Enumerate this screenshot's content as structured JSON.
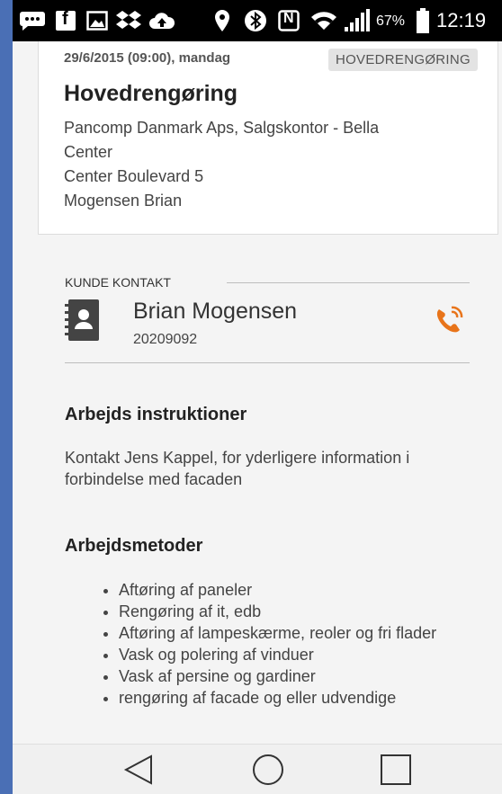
{
  "status_bar": {
    "icons": [
      "chat-icon",
      "facebook-icon",
      "image-icon",
      "dropbox-icon",
      "cloud-upload-icon",
      "location-icon",
      "bluetooth-icon",
      "nfc-icon",
      "wifi-icon",
      "signal-icon",
      "battery-icon"
    ],
    "nfc_glyph": "N",
    "facebook_glyph": "f",
    "battery_percent": "67%",
    "time": "12:19"
  },
  "task": {
    "date": "29/6/2015 (09:00), mandag",
    "badge": "HOVEDRENGØRING",
    "title": "Hovedrengøring",
    "address_lines": [
      "Pancomp Danmark Aps, Salgskontor - Bella",
      "Center",
      "Center Boulevard 5",
      "Mogensen Brian"
    ]
  },
  "contact": {
    "section_label": "KUNDE KONTAKT",
    "name": "Brian Mogensen",
    "phone": "20209092"
  },
  "instructions": {
    "heading": "Arbejds instruktioner",
    "text": "Kontakt Jens Kappel, for yderligere information i forbindelse med facaden"
  },
  "methods": {
    "heading": "Arbejdsmetoder",
    "items": [
      "Aftøring af paneler",
      "Rengøring af it, edb",
      "Aftøring af lampeskærme, reoler og fri flader",
      "Vask og polering af vinduer",
      "Vask af persine og gardiner",
      "rengøring af facade og eller udvendige"
    ]
  },
  "colors": {
    "accent_call": "#e8741a",
    "status_bar_bg": "#000000",
    "frame_left": "#4a6fb5"
  },
  "nav_bar": [
    "back-icon",
    "home-icon",
    "recents-icon"
  ]
}
